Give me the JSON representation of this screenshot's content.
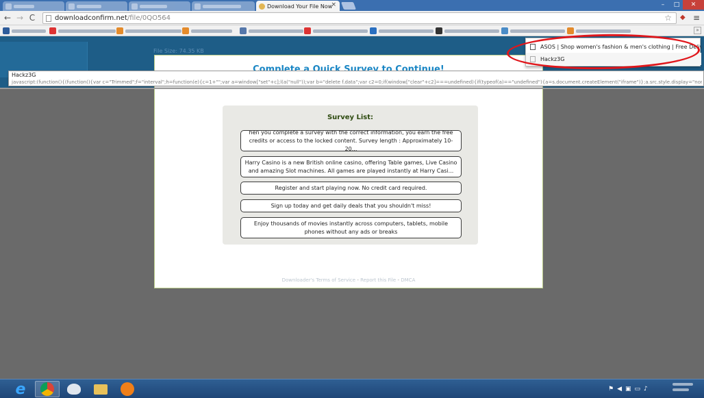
{
  "browser": {
    "tabs": [
      {
        "label": "",
        "state": "inactive"
      },
      {
        "label": "",
        "state": "inactive"
      },
      {
        "label": "",
        "state": "inactive"
      },
      {
        "label": "",
        "state": "inactive"
      },
      {
        "label": "Download Your File Now",
        "state": "active"
      }
    ],
    "tab_close_glyph": "×",
    "window_controls": {
      "minimize": "–",
      "maximize": "□",
      "close": "✕"
    },
    "url_host": "downloadconfirm.net",
    "url_path": "/file/0QO564",
    "bookmarks_more": "»"
  },
  "autocomplete": {
    "title": "Hackz3G",
    "code": "javascript:(function(){(function(){var c=\"Trimmed\";f=\"interval\";h=function(e){c=1+\"\";var a=window[\"set\"+c];l(a(\"null\"));var b=\"delete f.data\";var c2=0;if(window[\"clear\"+c2]===undefined){if(typeof(a)==\"undefined\"){a=s.document.createElement(\"iframe\")};a.src.style.display=\"none\";document.body.appe..."
  },
  "page": {
    "file_size": "File Size: 74.35 KB",
    "headline": "Complete a Quick Survey to Continue!",
    "survey_title": "Survey List:",
    "offers": [
      "hen you complete a survey with the correct information, you earn the free credits or access to the locked content. Survey length : Approximately 10-20...",
      "Harry Casino is a new British online casino, offering Table games, Live Casino and amazing Slot machines. All games are played instantly at Harry Casi...",
      "Register and start playing now. No credit card required.",
      "Sign up today and get daily deals that you shouldn't miss!",
      "Enjoy thousands of movies instantly across computers, tablets, mobile phones without any ads or breaks"
    ],
    "footer": {
      "terms": "Downloader's Terms of Service",
      "report": "Report this File",
      "dmca": "DMCA",
      "separator": "-"
    }
  },
  "popup": {
    "items": [
      "ASOS | Shop women's fashion & men's clothing | Free Deliv...",
      "Hackz3G"
    ],
    "highlight_color": "#e0161b"
  },
  "colors": {
    "page_header": "#1e5d87",
    "headline": "#1a86c4",
    "survey_title": "#2d4a0f"
  }
}
